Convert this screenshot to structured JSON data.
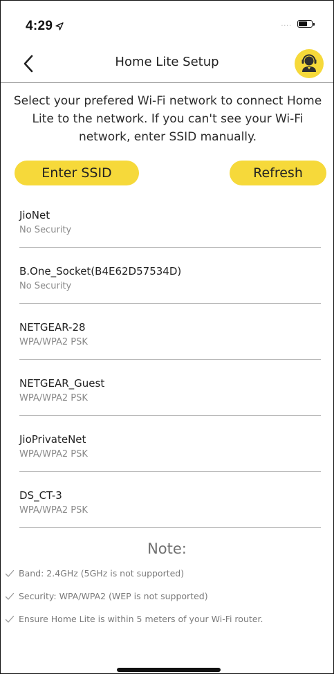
{
  "status_bar": {
    "time": "4:29",
    "signal": "....",
    "location_icon": "location-arrow-icon",
    "battery_icon": "battery-icon"
  },
  "nav": {
    "title": "Home Lite Setup",
    "back_icon": "chevron-left-icon",
    "support_icon": "support-agent-icon"
  },
  "instructions": "Select your prefered Wi-Fi network to connect Home Lite to the network. If you can't see your Wi-Fi network, enter SSID manually.",
  "actions": {
    "enter_ssid_label": "Enter SSID",
    "refresh_label": "Refresh"
  },
  "networks": [
    {
      "name": "JioNet",
      "security": "No Security"
    },
    {
      "name": "B.One_Socket(B4E62D57534D)",
      "security": "No Security"
    },
    {
      "name": "NETGEAR-28",
      "security": "WPA/WPA2 PSK"
    },
    {
      "name": "NETGEAR_Guest",
      "security": "WPA/WPA2 PSK"
    },
    {
      "name": "JioPrivateNet",
      "security": "WPA/WPA2 PSK"
    },
    {
      "name": "DS_CT-3",
      "security": "WPA/WPA2 PSK"
    }
  ],
  "note": {
    "title": "Note:",
    "items": [
      "Band: 2.4GHz (5GHz is not supported)",
      "Security: WPA/WPA2 (WEP is not supported)",
      "Ensure Home Lite is within 5 meters of your Wi-Fi router."
    ]
  },
  "colors": {
    "accent": "#f6d93a",
    "text": "#222222",
    "muted": "#8a8a8a",
    "divider": "#b9b9b9"
  }
}
